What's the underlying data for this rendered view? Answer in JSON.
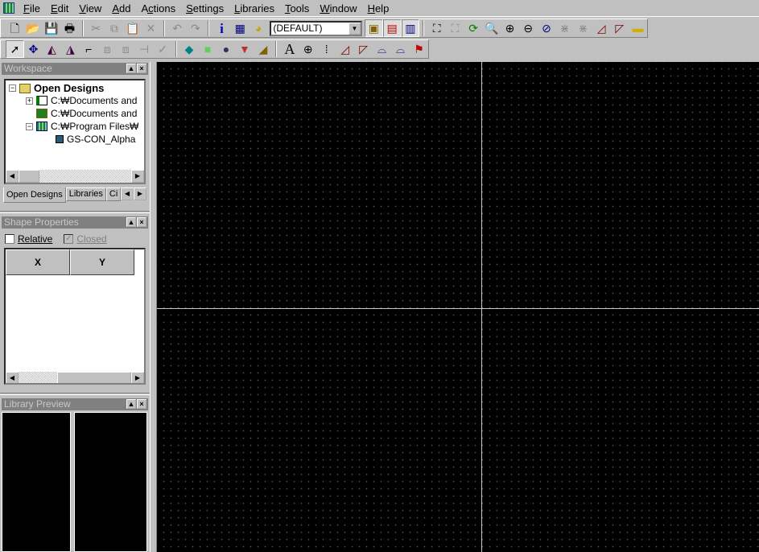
{
  "menubar": {
    "items": [
      {
        "label": "File",
        "u": "F"
      },
      {
        "label": "Edit",
        "u": "E"
      },
      {
        "label": "View",
        "u": "V"
      },
      {
        "label": "Add",
        "u": "A"
      },
      {
        "label": "Actions",
        "u": "c"
      },
      {
        "label": "Settings",
        "u": "S"
      },
      {
        "label": "Libraries",
        "u": "L"
      },
      {
        "label": "Tools",
        "u": "T"
      },
      {
        "label": "Window",
        "u": "W"
      },
      {
        "label": "Help",
        "u": "H"
      }
    ]
  },
  "toolbar1": {
    "items": [
      {
        "icon": "new-file-icon",
        "g": "🗋",
        "c": "#000"
      },
      {
        "icon": "open-folder-icon",
        "g": "📂",
        "c": "#b08000"
      },
      {
        "icon": "save-icon",
        "g": "💾",
        "c": "#000"
      },
      {
        "icon": "print-icon",
        "g": "🖶",
        "c": "#000"
      },
      "sep",
      {
        "icon": "cut-icon",
        "g": "✂",
        "dis": true
      },
      {
        "icon": "copy-icon",
        "g": "⧉",
        "dis": true
      },
      {
        "icon": "paste-icon",
        "g": "📋",
        "dis": true
      },
      {
        "icon": "delete-icon",
        "g": "✕",
        "dis": true
      },
      "sep",
      {
        "icon": "undo-icon",
        "g": "↶",
        "dis": true
      },
      {
        "icon": "redo-icon",
        "g": "↷",
        "dis": true
      },
      "sep",
      {
        "icon": "info-icon",
        "g": "i",
        "c": "#0000c0"
      },
      {
        "icon": "table-icon",
        "g": "▦",
        "c": "#000080"
      },
      {
        "icon": "palette-icon",
        "g": "◕",
        "c": "#d0a000"
      },
      "combo",
      {
        "icon": "view-layout-icon",
        "g": "▣",
        "c": "#806000",
        "pressed": true
      },
      {
        "icon": "form-icon",
        "g": "▤",
        "c": "#c00000",
        "pressed": true
      },
      {
        "icon": "chip-view-icon",
        "g": "▥",
        "c": "#000080",
        "pressed": true
      },
      "sep",
      {
        "icon": "zoom-extents-icon",
        "g": "⛶",
        "c": "#000"
      },
      {
        "icon": "zoom-window-icon",
        "g": "⛶",
        "dis": true
      },
      {
        "icon": "refresh-icon",
        "g": "⟳",
        "c": "#008000"
      },
      {
        "icon": "zoom-area-icon",
        "g": "🔍",
        "c": "#c00000"
      },
      {
        "icon": "zoom-in-icon",
        "g": "⊕",
        "c": "#000"
      },
      {
        "icon": "zoom-out-icon",
        "g": "⊖",
        "c": "#000"
      },
      {
        "icon": "zoom-previous-icon",
        "g": "⊘",
        "c": "#000080"
      },
      {
        "icon": "split-icon",
        "g": "⋇",
        "dis": true
      },
      {
        "icon": "join-icon",
        "g": "⋇",
        "dis": true
      },
      {
        "icon": "arc-edit-icon",
        "g": "◿",
        "c": "#800000"
      },
      {
        "icon": "arc-curve-icon",
        "g": "◸",
        "c": "#800000"
      },
      {
        "icon": "ruler-icon",
        "g": "▬",
        "c": "#d0b000"
      }
    ]
  },
  "toolbar2": {
    "items": [
      {
        "icon": "select-arrow-icon",
        "g": "➚",
        "c": "#000",
        "pressed": true
      },
      {
        "icon": "move-icon",
        "g": "✥",
        "c": "#000080"
      },
      {
        "icon": "rotate-icon",
        "g": "◭",
        "c": "#400040"
      },
      {
        "icon": "mirror-icon",
        "g": "◮",
        "c": "#400040"
      },
      {
        "icon": "route-icon",
        "g": "⌐",
        "c": "#000"
      },
      {
        "icon": "group-icon",
        "g": "⧈",
        "dis": true
      },
      {
        "icon": "ungroup-icon",
        "g": "⧈",
        "dis": true
      },
      {
        "icon": "trim-icon",
        "g": "⊣",
        "dis": true
      },
      {
        "icon": "check-icon",
        "g": "✓",
        "dis": true
      },
      "sep",
      {
        "icon": "3d-block-icon",
        "g": "◆",
        "c": "#008080"
      },
      {
        "icon": "rectangle-icon",
        "g": "■",
        "c": "#60d060"
      },
      {
        "icon": "circle-icon",
        "g": "●",
        "c": "#303060"
      },
      {
        "icon": "polygon-icon",
        "g": "▼",
        "c": "#c03030"
      },
      {
        "icon": "copper-pour-icon",
        "g": "◢",
        "c": "#806000"
      },
      "sep",
      {
        "icon": "text-icon",
        "g": "A",
        "c": "#000"
      },
      {
        "icon": "crosshair-icon",
        "g": "⊕",
        "c": "#000"
      },
      {
        "icon": "dimension-icon",
        "g": "⁞",
        "c": "#000"
      },
      {
        "icon": "arc-edit-icon",
        "g": "◿",
        "c": "#800000"
      },
      {
        "icon": "arc-curve-icon",
        "g": "◸",
        "c": "#800000"
      },
      {
        "icon": "arc-down-icon",
        "g": "⌓",
        "c": "#000080"
      },
      {
        "icon": "arc-up-icon",
        "g": "⌓",
        "c": "#000080"
      },
      {
        "icon": "flag-icon",
        "g": "⚑",
        "c": "#c00000"
      }
    ]
  },
  "layer_combo": {
    "value": "(DEFAULT)"
  },
  "workspace": {
    "title": "Workspace",
    "tree": [
      {
        "label": "Open Designs",
        "bold": true
      },
      {
        "label": "C:₩Documents and"
      },
      {
        "label": "C:₩Documents and"
      },
      {
        "label": "C:₩Program Files₩"
      },
      {
        "label": "GS-CON_Alpha"
      }
    ],
    "tabs": [
      "Open Designs",
      "Libraries",
      "Ci"
    ]
  },
  "shape_properties": {
    "title": "Shape Properties",
    "relative_label": "Relative",
    "closed_label": "Closed",
    "relative_checked": false,
    "closed_checked": true,
    "columns": [
      "X",
      "Y"
    ]
  },
  "library_preview": {
    "title": "Library Preview"
  }
}
